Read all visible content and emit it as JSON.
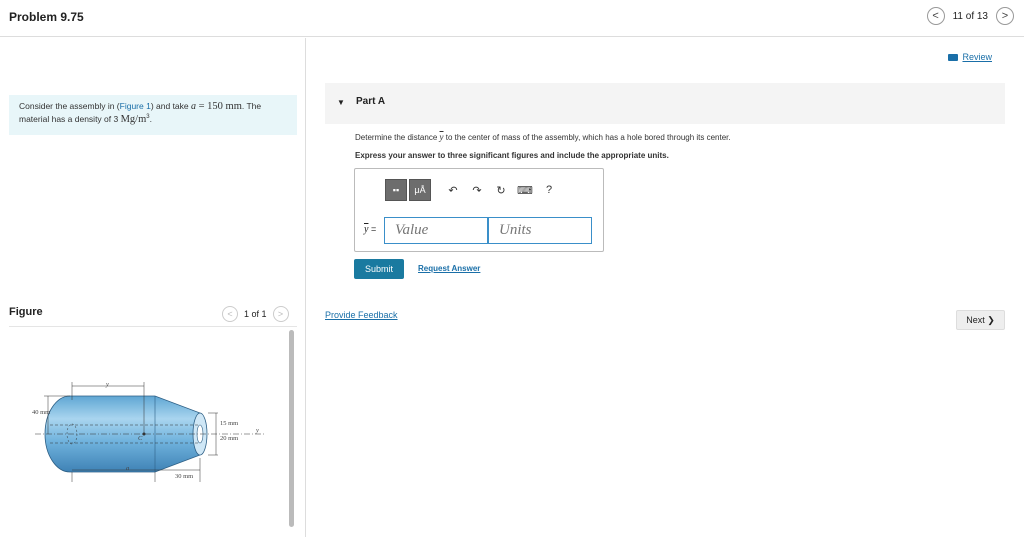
{
  "header": {
    "title": "Problem 9.75",
    "progress": "11 of 13",
    "prev_icon": "<",
    "next_icon": ">"
  },
  "problem": {
    "text_before": "Consider the assembly in (",
    "figure_link": "Figure 1",
    "text_mid": ") and take ",
    "a_var": "a",
    "a_value": " = 150 mm",
    "text_after": ". The material has a density of 3 ",
    "density_unit": "Mg/m",
    "density_exp": "3",
    "end": "."
  },
  "figure": {
    "label": "Figure",
    "pager": "1 of 1",
    "prev_icon": "<",
    "next_icon": ">",
    "labels": {
      "ybar": "y",
      "d40": "40 mm",
      "d15": "15 mm",
      "d20": "20 mm",
      "d30": "30 mm",
      "a": "a",
      "c": "C",
      "y": "y"
    }
  },
  "review": {
    "label": "Review"
  },
  "part": {
    "label": "Part A",
    "question_pre": "Determine the distance ",
    "question_var": "y",
    "question_post": " to the center of mass of the assembly, which has a hole bored through its center.",
    "instruction": "Express your answer to three significant figures and include the appropriate units.",
    "toolbar": {
      "templates": "▪▪",
      "units": "μÅ",
      "undo": "↶",
      "redo": "↷",
      "reset": "↻",
      "keyboard": "⌨",
      "help": "?"
    },
    "input_label_var": "y",
    "input_label_eq": " =",
    "value_placeholder": "Value",
    "units_placeholder": "Units",
    "submit": "Submit",
    "request": "Request Answer"
  },
  "feedback": "Provide Feedback",
  "next": "Next ❯"
}
